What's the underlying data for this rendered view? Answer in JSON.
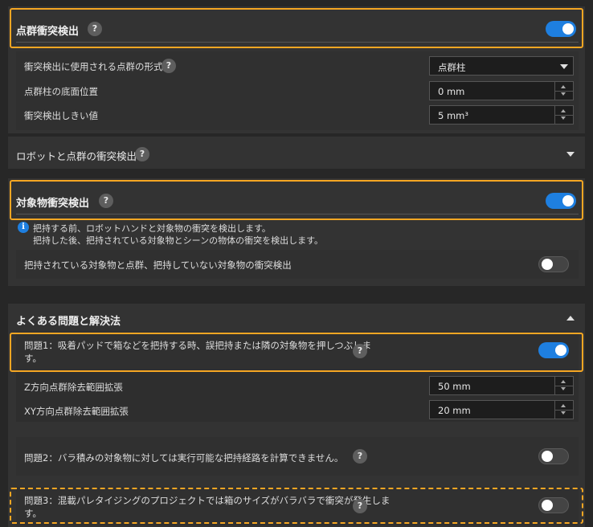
{
  "point_cloud_collision": {
    "title": "点群衝突検出",
    "enabled": true,
    "format_label": "衝突検出に使用される点群の形式",
    "format_value": "点群柱",
    "base_position_label": "点群柱の底面位置",
    "base_position_value": "0 mm",
    "threshold_label": "衝突検出しきい値",
    "threshold_value": "5 mm³"
  },
  "robot_point_cloud": {
    "title": "ロボットと点群の衝突検出"
  },
  "object_collision": {
    "title": "対象物衝突検出",
    "enabled": true,
    "info_line1": "把持する前、ロボットハンドと対象物の衝突を検出します。",
    "info_line2": "把持した後、把持されている対象物とシーンの物体の衝突を検出します。",
    "held_vs_cloud_label": "把持されている対象物と点群、把持していない対象物の衝突検出",
    "held_vs_cloud_enabled": false
  },
  "faq": {
    "title": "よくある問題と解決法",
    "q1_line1": "問題1：吸着パッドで箱などを把持する時、誤把持または隣の対象物を押しつぶしま",
    "q1_line2": "す。",
    "q1_enabled": true,
    "z_label": "Z方向点群除去範囲拡張",
    "z_value": "50 mm",
    "xy_label": "XY方向点群除去範囲拡張",
    "xy_value": "20 mm",
    "q2_label": "問題2：バラ積みの対象物に対しては実行可能な把持経路を計算できません。",
    "q2_enabled": false,
    "q3_label": "問題3：混載パレタイジングのプロジェクトでは箱のサイズがバラバラで衝突が発生しま",
    "q3_line2": "す。",
    "q3_enabled": false
  },
  "icons": {
    "help": "question-mark-icon",
    "info": "info-icon",
    "help_glyph": "?",
    "info_glyph": "i"
  },
  "colors": {
    "accent": "#1e7fe0",
    "highlight": "#f5a623",
    "panel": "#333333",
    "background": "#272727"
  }
}
